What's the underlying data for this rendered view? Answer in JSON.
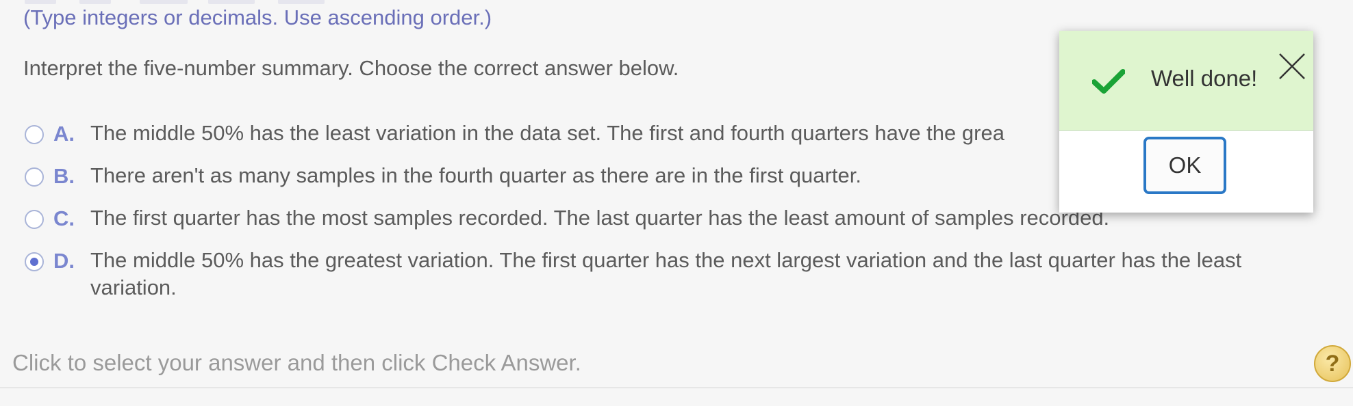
{
  "instructions": {
    "hint": "(Type integers or decimals. Use ascending order.)",
    "prompt": "Interpret the five-number summary. Choose the correct answer below."
  },
  "options": [
    {
      "letter": "A.",
      "text": "The middle 50% has the least variation in the data set. The first and fourth quarters have the grea",
      "selected": false
    },
    {
      "letter": "B.",
      "text": "There aren't as many samples in the fourth quarter as there are in the first quarter.",
      "selected": false
    },
    {
      "letter": "C.",
      "text": "The first quarter has the most samples recorded. The last quarter has the least amount of samples recorded.",
      "selected": false
    },
    {
      "letter": "D.",
      "text": "The middle 50% has the greatest variation. The first quarter has the next largest variation and the last quarter has the least variation.",
      "selected": true
    }
  ],
  "footer": {
    "text": "Click to select your answer and then click Check Answer.",
    "help_label": "?"
  },
  "modal": {
    "title": "Well done!",
    "ok_label": "OK",
    "header_color": "#dff5cf",
    "check_color": "#1aa336",
    "ok_border_color": "#2a78c6"
  }
}
